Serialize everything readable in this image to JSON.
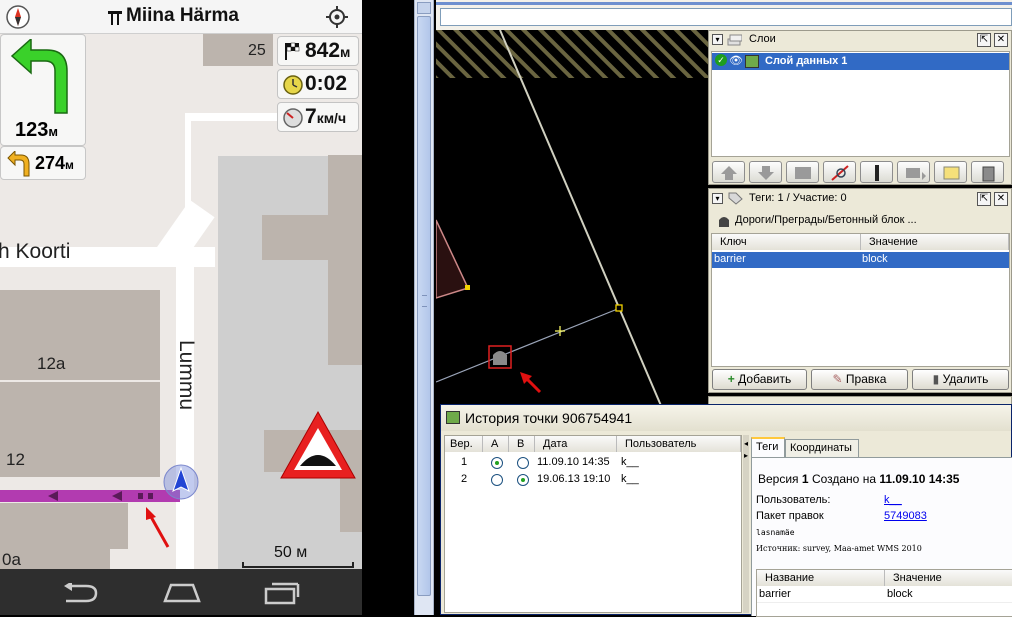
{
  "nav": {
    "street": "Miina Härma",
    "distance_to_finish": "842",
    "distance_unit": "м",
    "eta": "0:02",
    "speed": "7",
    "speed_unit": "км/ч",
    "next_turn_distance": "123",
    "next_turn_unit": "м",
    "second_turn_distance": "274",
    "second_turn_unit": "м",
    "map_labels": {
      "street_koorti": "h Koorti",
      "street_lummu": "Lummu",
      "house_25": "25",
      "house_12a": "12a",
      "house_12": "12",
      "house_0a": "0a"
    },
    "scale": "50 м"
  },
  "josm": {
    "layers": {
      "title": "Слои",
      "items": [
        {
          "name": "Слой данных 1"
        }
      ]
    },
    "tags": {
      "title": "Теги: 1 / Участие: 0",
      "preset": "Дороги/Преграды/Бетонный блок ...",
      "columns": [
        "Ключ",
        "Значение"
      ],
      "rows": [
        {
          "key": "barrier",
          "value": "block"
        }
      ],
      "buttons": {
        "add": "Добавить",
        "edit": "Правка",
        "delete": "Удалить"
      }
    },
    "history": {
      "title": "История точки 906754941",
      "columns": {
        "ver": "Вер.",
        "a": "A",
        "b": "B",
        "date": "Дата",
        "user": "Пользователь"
      },
      "rows": [
        {
          "ver": "1",
          "date": "11.09.10 14:35",
          "user": "k__",
          "a_checked": true,
          "b_checked": false
        },
        {
          "ver": "2",
          "date": "19.06.13 19:10",
          "user": "k__",
          "a_checked": false,
          "b_checked": true
        }
      ],
      "tabs": [
        "Теги",
        "Координаты"
      ],
      "version_prefix": "Версия",
      "version_number": "1",
      "created_on_label": "Создано на",
      "created_on_value": "11.09.10 14:35",
      "user_label": "Пользователь:",
      "user_value": "k__",
      "changeset_label": "Пакет правок",
      "changeset_value": "5749083",
      "comment": "lasnamäe",
      "source": "Источник: survey, Maa-amet WMS 2010",
      "tag_columns": [
        "Название",
        "Значение"
      ],
      "tag_rows": [
        {
          "key": "barrier",
          "value": "block"
        }
      ]
    }
  },
  "colors": {
    "route": "#b23bb0",
    "selection": "#316ac5",
    "map_background": "#000000",
    "map_area": "#ede9e6"
  }
}
